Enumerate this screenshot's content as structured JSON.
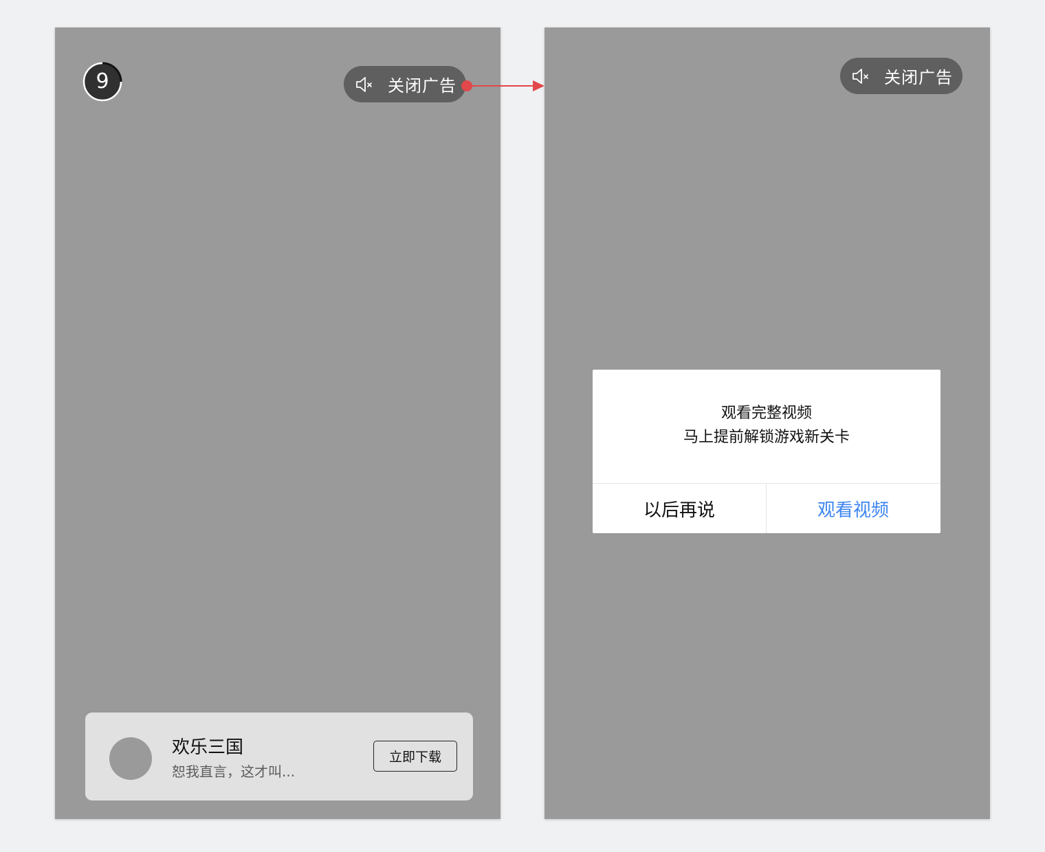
{
  "ad_screen": {
    "countdown": "9",
    "close_label": "关闭广告",
    "ad_card": {
      "app_name": "欢乐三国",
      "description": "恕我直言，这才叫...",
      "download_label": "立即下载"
    },
    "icons": {
      "mute": "speaker-muted-icon"
    }
  },
  "dialog_screen": {
    "close_label": "关闭广告",
    "dialog": {
      "line1": "观看完整视频",
      "line2": "马上提前解锁游戏新关卡",
      "secondary_label": "以后再说",
      "primary_label": "观看视频"
    }
  },
  "colors": {
    "screen_bg": "#9a9a9a",
    "page_bg": "#f0f1f3",
    "pill_bg": "#5f5f5f",
    "card_bg": "#e1e1e1",
    "primary_link": "#3e86f0",
    "arrow": "#e2474a"
  }
}
